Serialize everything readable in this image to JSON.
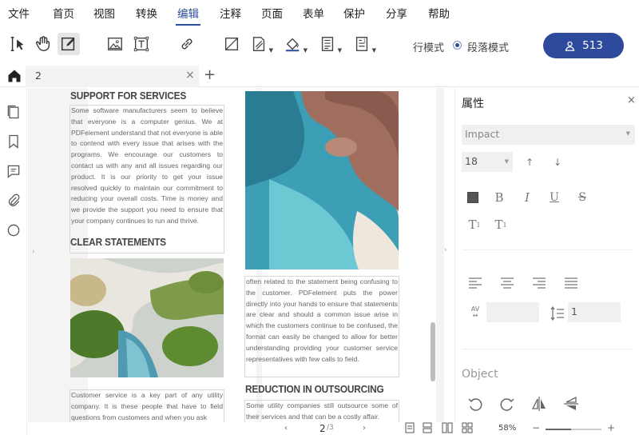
{
  "menu": {
    "items": [
      "文件",
      "首页",
      "视图",
      "转换",
      "编辑",
      "注释",
      "页面",
      "表单",
      "保护",
      "分享",
      "帮助"
    ],
    "active_index": 4
  },
  "toolbar": {
    "mode_line": "行模式",
    "mode_paragraph": "段落模式",
    "user_count": "513"
  },
  "tabs": {
    "doc_name": "2",
    "close": "×",
    "new": "+"
  },
  "document": {
    "page1": {
      "heading1": "SUPPORT FOR SERVICES",
      "para1": "Some software manufacturers seem to believe that everyone is a computer genius. We at PDFelement understand that not everyone is able to contend with every issue that arises with the programs. We encourage our customers to contact us with any and all issues regarding our product. It is our priority to get your issue resolved quickly to maintain our commitment to reducing your overall costs. Time is money and we provide the support you need to ensure that your company continues to run and thrive.",
      "heading2": "CLEAR STATEMENTS",
      "para2": "Customer service is a key part of any utility company. It is these people that have to field questions from customers and when you ask"
    },
    "page2": {
      "para1": "often related to the statement being confusing to the customer. PDFelement puts the power directly into your hands to ensure that statements are clear and should a common issue arise in which the customers continue to be confused, the format can easily be changed to allow for better understanding providing your customer service representatives with few calls to field.",
      "heading1": "REDUCTION IN OUTSOURCING",
      "para2": "Some utility companies still outsource some of their services and that can be a costly affair."
    }
  },
  "status": {
    "page_current": "2",
    "page_total": "/3",
    "zoom": "58%",
    "zoom_fraction": 0.45,
    "minus": "−",
    "plus": "+"
  },
  "properties": {
    "title": "属性",
    "close": "×",
    "font": "Impact",
    "size": "18",
    "bold": "B",
    "italic": "I",
    "underline": "U",
    "strike": "S",
    "superscript": "T",
    "subscript": "T",
    "char_spacing_label": "AV",
    "line_spacing": "1",
    "object_label": "Object",
    "text_color": "#555555"
  }
}
